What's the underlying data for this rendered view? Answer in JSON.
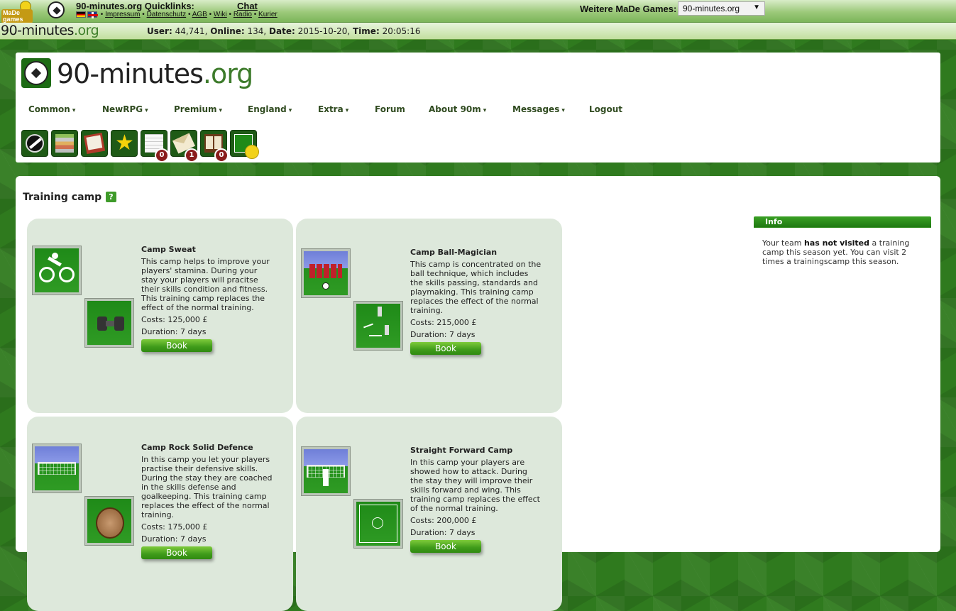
{
  "topbar": {
    "made_logo_text": "MaDe games",
    "quicklinks_title": "90-minutes.org Quicklinks:",
    "chat_label": "Chat",
    "links": [
      "Impressum",
      "Datenschutz",
      "AGB",
      "Wiki",
      "Radio",
      "Kurier"
    ],
    "more_games_label": "Weitere MaDe Games:",
    "games_select_value": "90-minutes.org"
  },
  "infobar": {
    "site_name_a": "90-minutes",
    "site_name_b": ".org",
    "user_label": "User:",
    "user_value": "44,741",
    "online_label": "Online:",
    "online_value": "134",
    "date_label": "Date:",
    "date_value": "2015-10-20",
    "time_label": "Time:",
    "time_value": "20:05:16"
  },
  "header": {
    "logo_a": "90-minutes",
    "logo_b": ".org",
    "nav": [
      {
        "label": "Common",
        "dropdown": true
      },
      {
        "label": "NewRPG",
        "dropdown": true
      },
      {
        "label": "Premium",
        "dropdown": true
      },
      {
        "label": "England",
        "dropdown": true
      },
      {
        "label": "Extra",
        "dropdown": true
      },
      {
        "label": "Forum",
        "dropdown": false
      },
      {
        "label": "About 90m",
        "dropdown": true
      },
      {
        "label": "Messages",
        "dropdown": true
      },
      {
        "label": "Logout",
        "dropdown": false
      }
    ],
    "caret": "▾",
    "quick_icons": [
      {
        "name": "club-badge-icon"
      },
      {
        "name": "league-table-icon"
      },
      {
        "name": "notebook-icon"
      },
      {
        "name": "star-icon"
      },
      {
        "name": "calendar-icon",
        "badge": "0"
      },
      {
        "name": "mail-icon",
        "badge": "1"
      },
      {
        "name": "guestbook-icon",
        "badge": "0"
      },
      {
        "name": "pitch-training-icon"
      }
    ]
  },
  "main": {
    "title": "Training camp",
    "help": "?",
    "camps": [
      {
        "title": "Camp Sweat",
        "desc": "This camp helps to improve your players' stamina. During your stay your players will pracitse their skills condition and fitness. This training camp replaces the effect of the normal training.",
        "costs": "Costs: 125,000 £",
        "duration": "Duration: 7 days",
        "book": "Book"
      },
      {
        "title": "Camp Ball-Magician",
        "desc": "This camp is concentrated on the ball technique, which includes the skills passing, standards and playmaking. This training camp replaces the effect of the normal training.",
        "costs": "Costs: 215,000 £",
        "duration": "Duration: 7 days",
        "book": "Book"
      },
      {
        "title": "Camp Rock Solid Defence",
        "desc": "In this camp you let your players practise their defensive skills. During the stay they are coached in the skills defense and goalkeeping. This training camp replaces the effect of the normal training.",
        "costs": "Costs: 175,000 £",
        "duration": "Duration: 7 days",
        "book": "Book"
      },
      {
        "title": "Straight Forward Camp",
        "desc": "In this camp your players are showed how to attack. During the stay they will improve their skills forward and wing. This training camp replaces the effect of the normal training.",
        "costs": "Costs: 200,000 £",
        "duration": "Duration: 7 days",
        "book": "Book"
      }
    ],
    "info": {
      "header": "Info",
      "text_a": "Your team ",
      "text_b": "has not visited",
      "text_c": " a training camp this season yet. You can visit 2 times a trainingscamp this season."
    }
  },
  "colors": {
    "accent_green": "#3f9b1a",
    "card_bg": "#dde8db",
    "badge_red": "#8a1c1c"
  }
}
